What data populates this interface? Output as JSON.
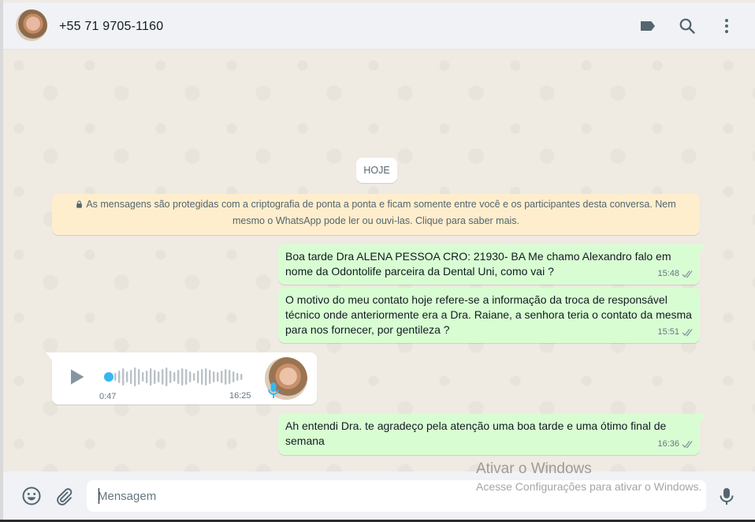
{
  "header": {
    "contact_name": "+55 71 9705-1160",
    "icons": [
      "label-icon",
      "search-icon",
      "menu-icon"
    ]
  },
  "chat": {
    "date_chip": "HOJE",
    "encryption_notice": "As mensagens são protegidas com a criptografia de ponta a ponta e ficam somente entre você e os participantes desta conversa. Nem mesmo o WhatsApp pode ler ou ouvi-las. Clique para saber mais.",
    "messages": [
      {
        "direction": "out",
        "text": "Boa tarde Dra ALENA PESSOA CRO: 21930- BA Me chamo Alexandro falo em nome da Odontolife parceira da Dental Uni, como vai ?",
        "time": "15:48",
        "status": "read"
      },
      {
        "direction": "out",
        "text": "O motivo do meu contato hoje refere-se a informação da troca de responsável técnico onde anteriormente era a Dra. Raiane, a senhora teria o contato da mesma para nos fornecer, por gentileza ?",
        "time": "15:51",
        "status": "read"
      },
      {
        "direction": "in",
        "type": "audio",
        "duration": "0:47",
        "time": "16:25"
      },
      {
        "direction": "out",
        "text": "Ah entendi Dra. te agradeço pela atenção uma boa tarde e uma ótimo final de semana",
        "time": "16:36",
        "status": "read"
      }
    ]
  },
  "composer": {
    "placeholder": "Mensagem",
    "value": ""
  },
  "watermark": {
    "title": "Ativar o Windows",
    "subtitle": "Acesse Configurações para ativar o Windows."
  },
  "colors": {
    "outgoing_bubble": "#d9fdd3",
    "incoming_bubble": "#ffffff",
    "notice_bg": "#ffeecd",
    "read_ticks": "#53bdeb",
    "audio_accent": "#34b7f1"
  }
}
